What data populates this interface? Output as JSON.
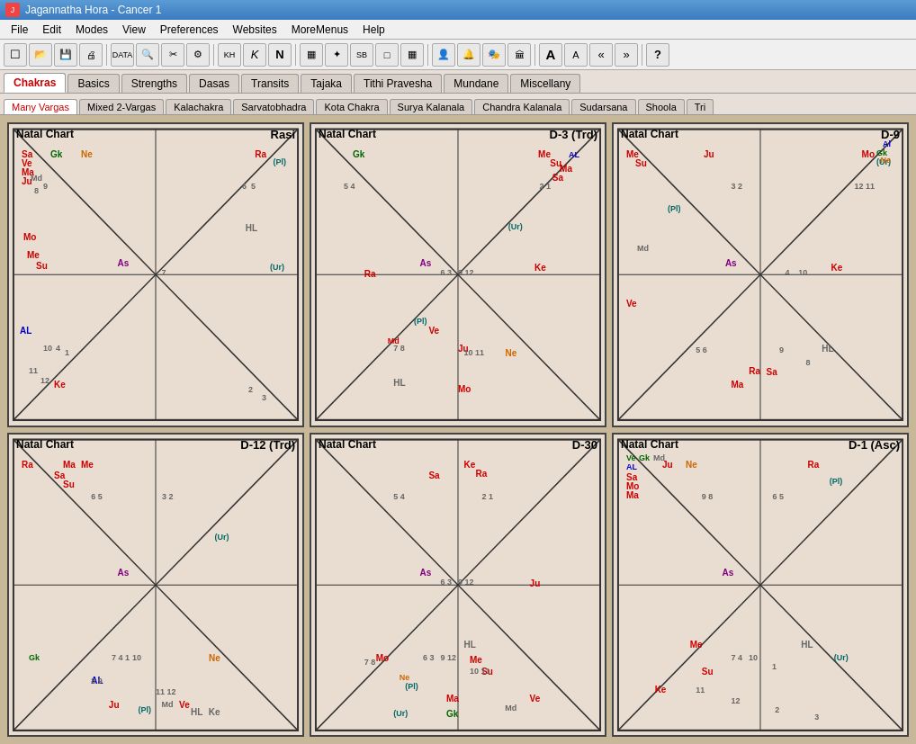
{
  "titlebar": {
    "title": "Jagannatha Hora - Cancer 1",
    "icon": "jh-icon"
  },
  "menubar": {
    "items": [
      "File",
      "Edit",
      "Modes",
      "View",
      "Preferences",
      "Websites",
      "MoreMenus",
      "Help"
    ]
  },
  "toolbar": {
    "buttons": [
      "☐",
      "📂",
      "💾",
      "🖨",
      "📊",
      "📋",
      "✂",
      "🔗",
      "⚙",
      "K",
      "N",
      "▦",
      "✦",
      "SB",
      "□",
      "▦",
      "👤",
      "🔔",
      "🎭",
      "🏛",
      "A",
      "A",
      "«",
      "»",
      "?"
    ]
  },
  "tabs": {
    "main": [
      "Chakras",
      "Basics",
      "Strengths",
      "Dasas",
      "Transits",
      "Tajaka",
      "Tithi Pravesha",
      "Mundane",
      "Miscellany"
    ],
    "main_active": "Chakras",
    "sub": [
      "Many Vargas",
      "Mixed 2-Vargas",
      "Kalachakra",
      "Sarvatobhadra",
      "Kota Chakra",
      "Surya Kalanala",
      "Chandra Kalanala",
      "Sudarsana",
      "Shoola",
      "Tri"
    ],
    "sub_active": "Many Vargas"
  },
  "charts": [
    {
      "id": "rasi",
      "title": "Natal Chart",
      "label": "Rasi",
      "planets": {
        "top_left": [
          "Sa",
          "Ve",
          "Ma",
          "Ju"
        ],
        "top_left2": [
          "Gk"
        ],
        "top_left3": [
          "Md"
        ],
        "top_center_left": [
          "Ne"
        ],
        "top_center": [],
        "top_right": [
          "Ra"
        ],
        "mid_left_label": [
          "As"
        ],
        "mid_right": [
          "(Pl)"
        ],
        "lower_left": [
          "Mo",
          "Su"
        ],
        "lower_left2": [
          "Me"
        ],
        "lower_center": [
          "HL",
          "(Ur)"
        ],
        "bottom_left": [
          "AL"
        ],
        "bottom_center": [
          "Ke"
        ],
        "nums": [
          "9",
          "8",
          "6",
          "5",
          "7",
          "10",
          "4",
          "1",
          "11",
          "12",
          "2",
          "3"
        ]
      }
    },
    {
      "id": "d3",
      "title": "Natal Chart",
      "label": "D-3 (Trd)",
      "planets": {}
    },
    {
      "id": "d9",
      "title": "Natal Chart",
      "label": "D-9",
      "planets": {}
    },
    {
      "id": "d12",
      "title": "Natal Chart",
      "label": "D-12 (Trd)",
      "planets": {}
    },
    {
      "id": "d30",
      "title": "Natal Chart",
      "label": "D-30",
      "planets": {}
    },
    {
      "id": "d1asc",
      "title": "Natal Chart",
      "label": "D-1 (Asc)",
      "planets": {}
    }
  ],
  "colors": {
    "background": "#c8b89a",
    "chart_bg": "#e8ddd0",
    "border": "#444444",
    "active_tab": "#ffffff",
    "tab_bg": "#d8d0c8"
  }
}
